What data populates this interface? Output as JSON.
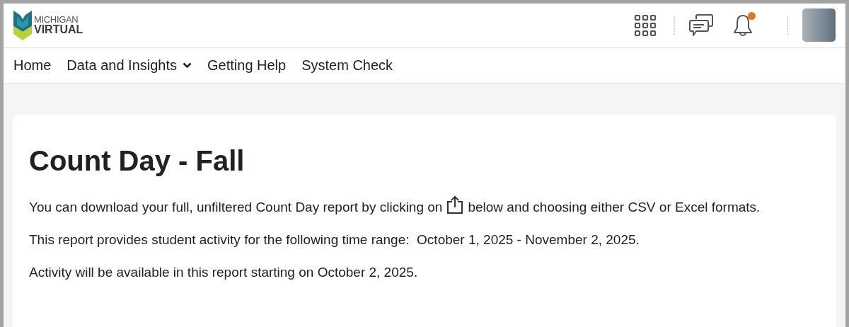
{
  "logo": {
    "line_1": "MICHIGAN",
    "line_2": "VIRTUAL"
  },
  "header": {
    "notifications_unread": true
  },
  "nav": [
    {
      "label": "Home",
      "kind": "link"
    },
    {
      "label": "Data and Insights",
      "kind": "dropdown"
    },
    {
      "label": "Getting Help",
      "kind": "link"
    },
    {
      "label": "System Check",
      "kind": "link"
    }
  ],
  "page": {
    "title": "Count Day - Fall",
    "paragraphs": [
      {
        "before_icon": "You can download your full, unfiltered Count Day report by clicking on",
        "after_icon": "below and choosing either CSV or Excel formats."
      },
      {
        "text": "This report provides student activity for the following time range:  October 1, 2025 - November 2, 2025."
      },
      {
        "text": "Activity will be available in this report starting on October 2, 2025."
      }
    ]
  }
}
